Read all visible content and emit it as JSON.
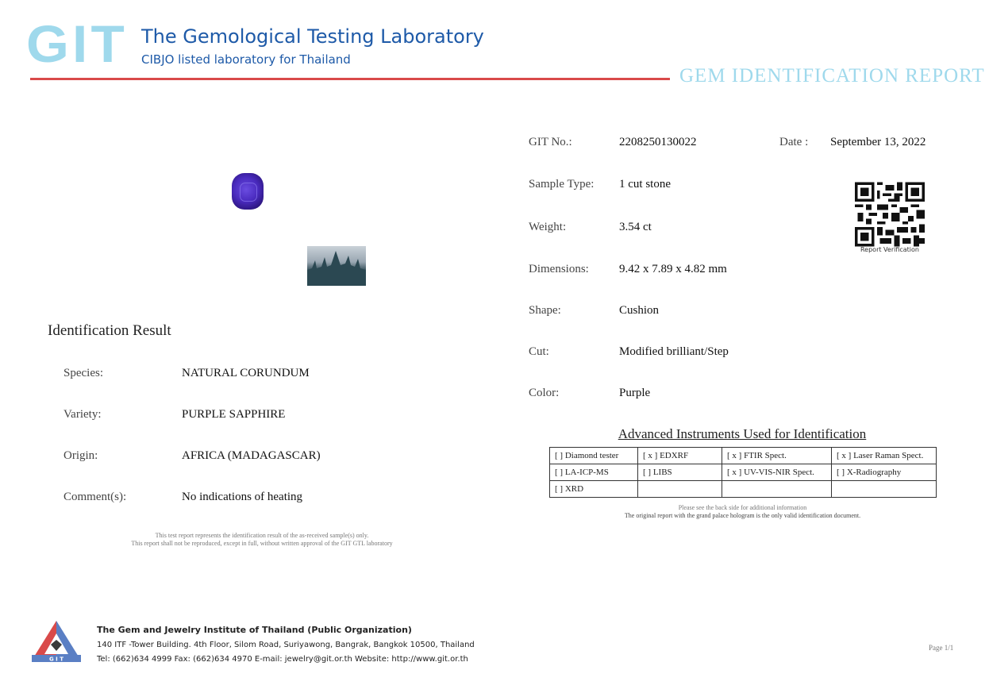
{
  "header": {
    "logo_text": "GIT",
    "lab_name": "The Gemological Testing Laboratory",
    "lab_subtitle": "CIBJO listed laboratory for Thailand",
    "report_title": "GEM IDENTIFICATION REPORT"
  },
  "report": {
    "git_no_label": "GIT No.:",
    "git_no": "2208250130022",
    "date_label": "Date :",
    "date": "September 13, 2022",
    "sample_type_label": "Sample Type:",
    "sample_type": "1 cut stone",
    "weight_label": "Weight:",
    "weight": "3.54  ct",
    "dimensions_label": "Dimensions:",
    "dimensions": "9.42 x 7.89 x 4.82 mm",
    "shape_label": "Shape:",
    "shape": "Cushion",
    "cut_label": "Cut:",
    "cut": "Modified brilliant/Step",
    "color_label": "Color:",
    "color": "Purple"
  },
  "qr": {
    "label": "Report Verification",
    "icon": "qr-code-icon"
  },
  "identification": {
    "title": "Identification Result",
    "species_label": "Species:",
    "species": "NATURAL  CORUNDUM",
    "variety_label": "Variety:",
    "variety": "PURPLE  SAPPHIRE",
    "origin_label": "Origin:",
    "origin": "AFRICA  (MADAGASCAR)",
    "comment_label": "Comment(s):",
    "comment": "No indications of heating",
    "disclaimer_1": "This test report represents the identification result of the as-received sample(s) only.",
    "disclaimer_2": "This report shall not be reproduced, except in full, without written approval of the GIT GTL laboratory"
  },
  "instruments": {
    "title": "Advanced Instruments Used for Identification",
    "rows": [
      [
        "[   ] Diamond tester",
        "[ x ] EDXRF",
        "[ x ] FTIR Spect.",
        "[ x ] Laser Raman Spect."
      ],
      [
        "[   ] LA-ICP-MS",
        "[   ] LIBS",
        "[ x ] UV-VIS-NIR Spect.",
        "[   ] X-Radiography"
      ],
      [
        "[   ] XRD",
        "",
        "",
        ""
      ]
    ],
    "note_1": "Please see the back side for additional information",
    "note_2": "The original report with the grand palace hologram is the only valid identification document."
  },
  "footer": {
    "institute": "The Gem and Jewelry Institute of Thailand (Public Organization)",
    "address": "140 ITF -Tower Building. 4th Floor, Silom Road, Suriyawong, Bangrak, Bangkok 10500, Thailand",
    "contact": "Tel: (662)634 4999 Fax: (662)634 4970  E-mail: jewelry@git.or.th  Website: http://www.git.or.th",
    "page": "Page 1/1"
  },
  "colors": {
    "brand_blue": "#1e5aa8",
    "logo_cyan": "#9fd9ec",
    "rule_red": "#d94a4a",
    "gem_purple": "#4a2bbf"
  }
}
